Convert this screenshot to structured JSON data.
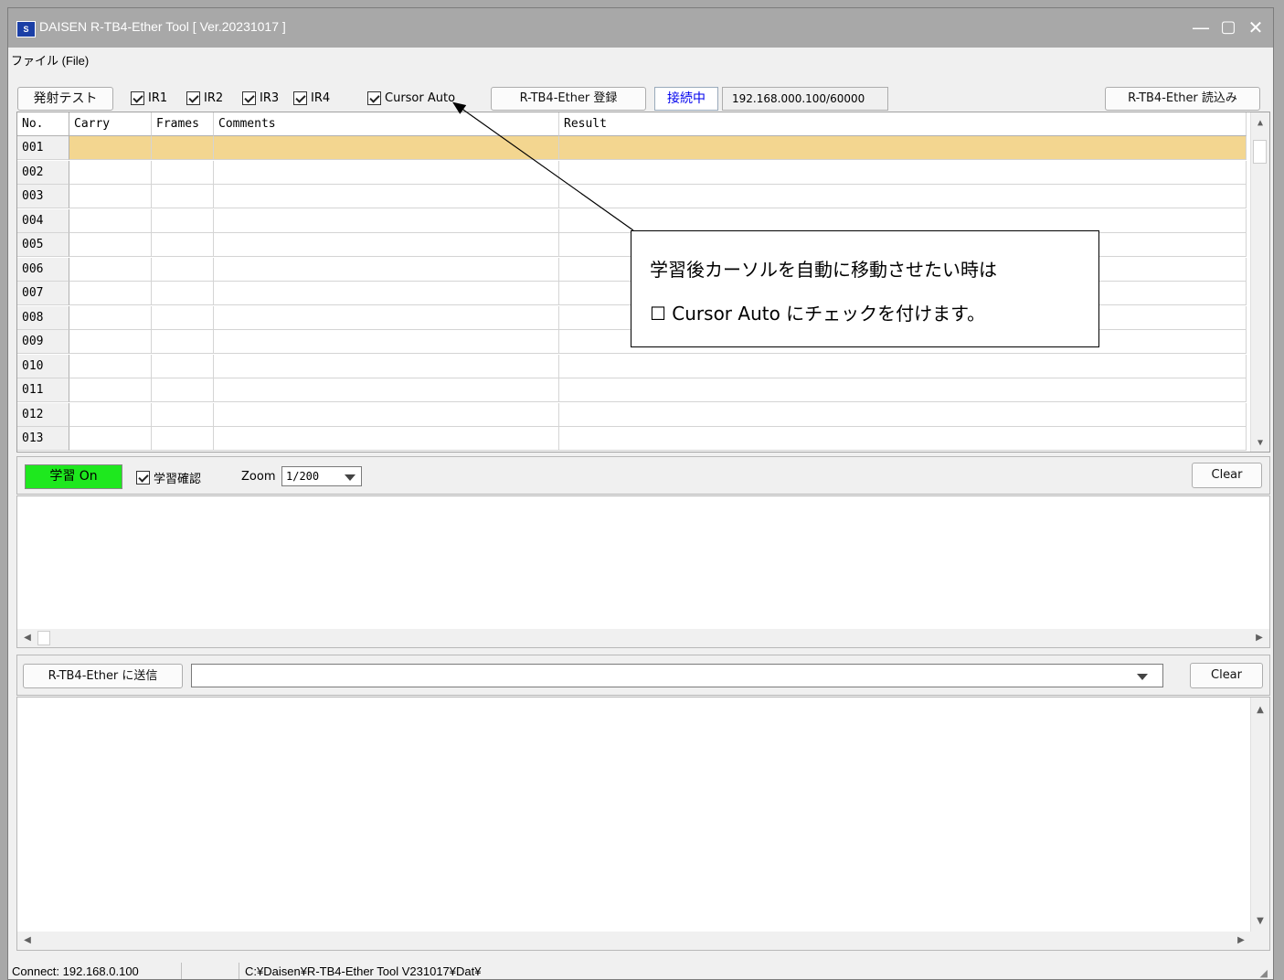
{
  "window": {
    "title": "DAISEN R-TB4-Ether Tool  [ Ver.20231017 ]",
    "icon_text": "S",
    "controls": [
      "—",
      "▢",
      "✕"
    ]
  },
  "menu": {
    "file_label": "ファイル (File)"
  },
  "toolbar": {
    "fire_test_label": "発射テスト",
    "ir1_label": "IR1",
    "ir2_label": "IR2",
    "ir3_label": "IR3",
    "ir4_label": "IR4",
    "cursor_auto_label": "Cursor Auto",
    "register_label": "R-TB4-Ether 登録",
    "connection_status": "接続中",
    "address": "192.168.000.100/60000",
    "read_label": "R-TB4-Ether 読込み"
  },
  "grid": {
    "headers": [
      "No.",
      "Carry",
      "Frames",
      "Comments",
      "Result"
    ],
    "rows": [
      "001",
      "002",
      "003",
      "004",
      "005",
      "006",
      "007",
      "008",
      "009",
      "010",
      "011",
      "012",
      "013"
    ],
    "selected_row": "001"
  },
  "learn": {
    "learn_on_label": "学習 On",
    "confirm_label": "学習確認",
    "zoom_label": "Zoom",
    "zoom_value": "1/200",
    "clear_label": "Clear"
  },
  "send": {
    "send_label": "R-TB4-Ether に送信",
    "input_value": "",
    "clear_label": "Clear"
  },
  "statusbar": {
    "connect": "Connect: 192.168.0.100",
    "path": "C:¥Daisen¥R-TB4-Ether Tool V231017¥Dat¥"
  },
  "callout": {
    "line1": "学習後カーソルを自動に移動させたい時は",
    "line2": "☐  Cursor Auto にチェックを付けます。"
  },
  "colors": {
    "title_bar": "#a8a8a8",
    "selected_row": "#f3d690",
    "learn_on": "#1ee81e",
    "connected_text": "#0000ee"
  }
}
